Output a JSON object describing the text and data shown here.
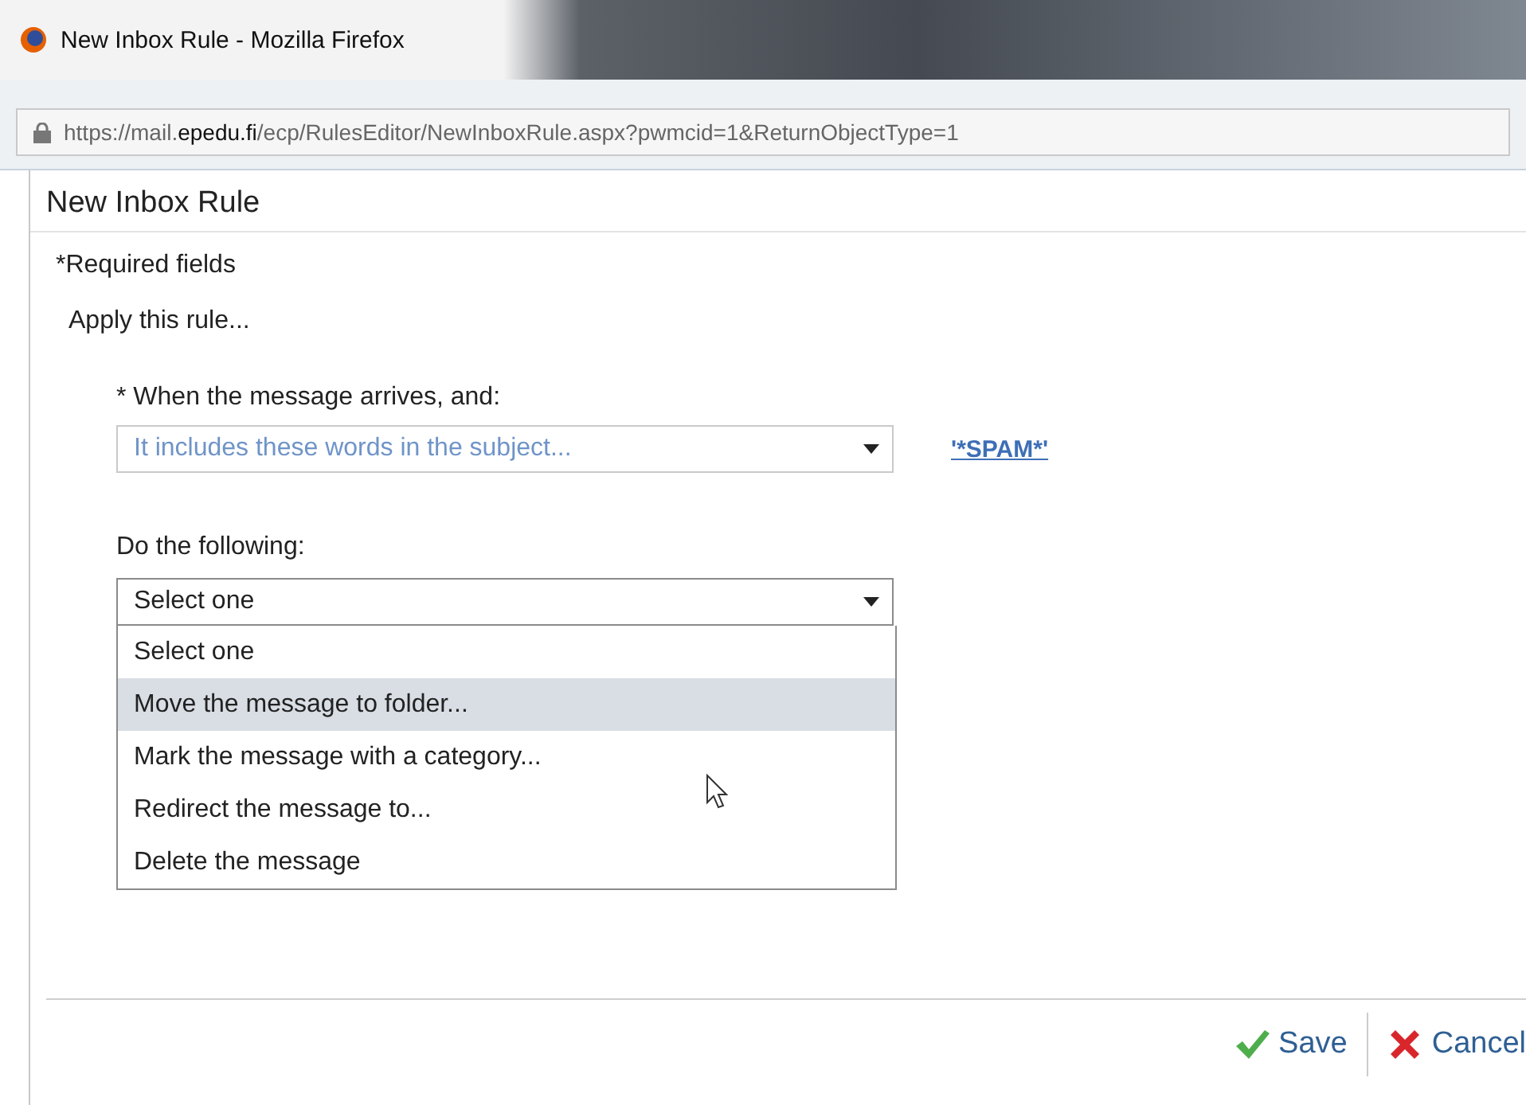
{
  "window": {
    "title": "New Inbox Rule - Mozilla Firefox"
  },
  "address_bar": {
    "url": "https://mail.**epedu.fi**/ecp/RulesEditor/NewInboxRule.aspx?pwmcid=1&ReturnObjectType=1"
  },
  "page": {
    "title": "New Inbox Rule",
    "required_note": "*Required fields",
    "section": "Apply this rule..."
  },
  "condition": {
    "label": "* When the message arrives, and:",
    "value": "It includes these words in the subject...",
    "link": "'*SPAM*'"
  },
  "action": {
    "label": "Do the following:",
    "value": "Select one",
    "expanded": true,
    "options": [
      {
        "label": "Select one",
        "highlighted": false
      },
      {
        "label": "Move the message to folder...",
        "highlighted": true
      },
      {
        "label": "Mark the message with a category...",
        "highlighted": false
      },
      {
        "label": "Redirect the message to...",
        "highlighted": false
      },
      {
        "label": "Delete the message",
        "highlighted": false
      }
    ]
  },
  "buttons": [
    {
      "kind": "save",
      "label": "Save"
    },
    {
      "kind": "cancel",
      "label": "Cancel"
    }
  ]
}
